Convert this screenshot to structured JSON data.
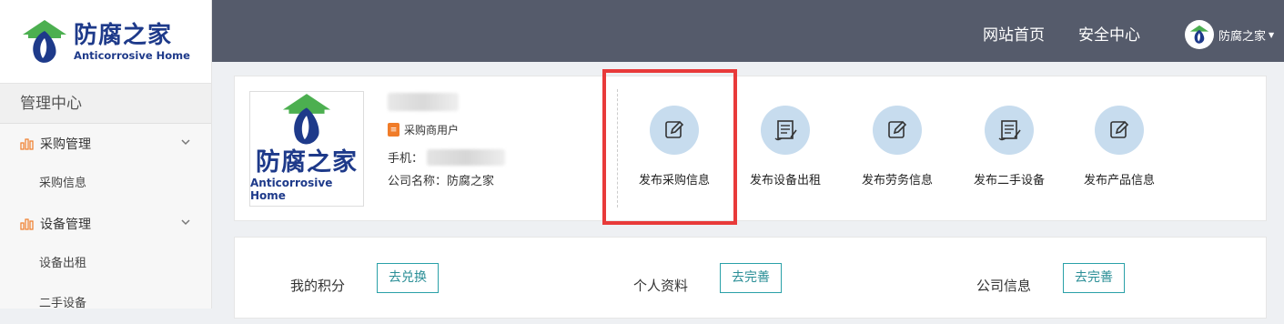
{
  "brand": {
    "name_cn": "防腐之家",
    "name_en": "Anticorrosive Home",
    "color": "#1e3a8a",
    "accent_green": "#4caf50"
  },
  "sidebar": {
    "title": "管理中心",
    "groups": [
      {
        "label": "采购管理",
        "icon": "bar-chart-icon",
        "items": [
          "采购信息"
        ]
      },
      {
        "label": "设备管理",
        "icon": "bar-chart-icon",
        "items": [
          "设备出租",
          "二手设备"
        ]
      }
    ]
  },
  "topbar": {
    "nav": [
      "网站首页",
      "安全中心"
    ],
    "user_name": "防腐之家"
  },
  "profile": {
    "role": "采购商用户",
    "phone_label": "手机：",
    "company_label": "公司名称：防腐之家"
  },
  "actions": [
    {
      "label": "发布采购信息",
      "icon": "edit-icon"
    },
    {
      "label": "发布设备出租",
      "icon": "document-icon"
    },
    {
      "label": "发布劳务信息",
      "icon": "edit-icon"
    },
    {
      "label": "发布二手设备",
      "icon": "document-icon"
    },
    {
      "label": "发布产品信息",
      "icon": "edit-icon"
    }
  ],
  "stats": [
    {
      "label": "我的积分",
      "button": "去兑换"
    },
    {
      "label": "个人资料",
      "button": "去完善"
    },
    {
      "label": "公司信息",
      "button": "去完善"
    }
  ],
  "colors": {
    "topbar": "#555b6b",
    "highlight": "#e83a3a",
    "icon_circle": "#c7dcee",
    "teal": "#2aa1a8"
  }
}
